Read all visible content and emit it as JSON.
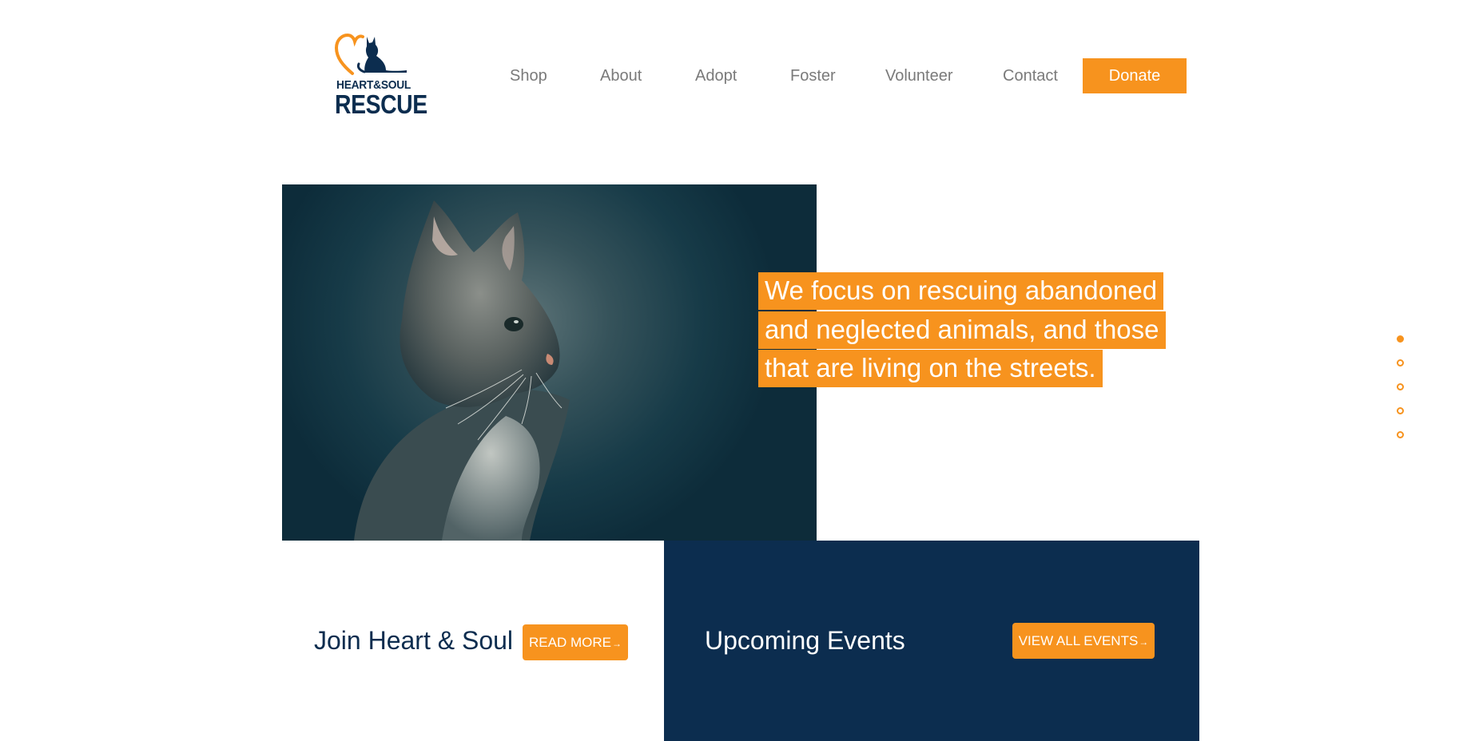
{
  "brand": {
    "line1": "HEART&SOUL",
    "line2": "RESCUE",
    "orange": "#f7931e",
    "navy": "#0c2d4f"
  },
  "nav": {
    "items": [
      {
        "label": "Shop"
      },
      {
        "label": "About"
      },
      {
        "label": "Adopt"
      },
      {
        "label": "Foster"
      },
      {
        "label": "Volunteer"
      },
      {
        "label": "Contact"
      }
    ],
    "donate_label": "Donate"
  },
  "hero": {
    "image_subject": "cat-photo",
    "tagline": "We focus on rescuing abandoned and neglected animals, and those that are living on the streets.",
    "slide_count": 5,
    "active_slide": 1
  },
  "join": {
    "title": "Join Heart & Soul",
    "button_label": "READ MORE",
    "button_icon": "arrow-right-icon"
  },
  "events": {
    "title": "Upcoming Events",
    "button_label": "VIEW ALL EVENTS",
    "button_icon": "arrow-right-icon"
  }
}
